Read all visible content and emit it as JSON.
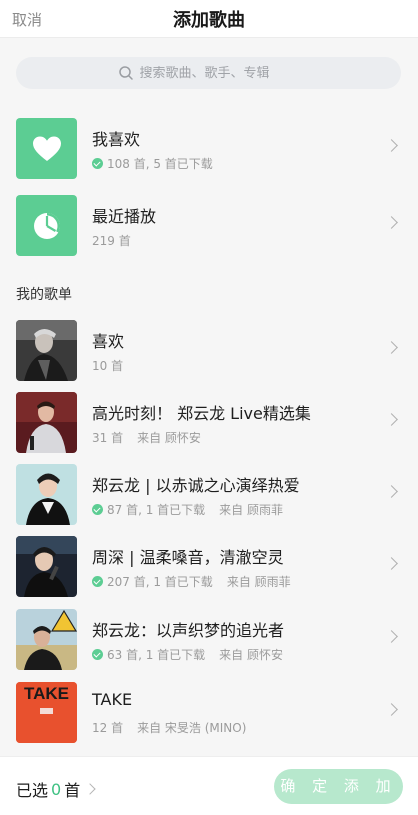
{
  "header": {
    "cancel": "取消",
    "title": "添加歌曲"
  },
  "search": {
    "placeholder": "搜索歌曲、歌手、专辑",
    "icon": "search-icon"
  },
  "top_lists": [
    {
      "name": "我喜欢",
      "meta": "108 首, 5 首已下载",
      "downloaded": true,
      "icon": "heart-icon"
    },
    {
      "name": "最近播放",
      "meta": "219 首",
      "downloaded": false,
      "icon": "clock-icon"
    }
  ],
  "section_title": "我的歌单",
  "playlists": [
    {
      "name": "喜欢",
      "meta": "10 首",
      "source": "",
      "downloaded": false
    },
    {
      "name": "高光时刻！ 郑云龙 Live精选集",
      "meta": "31 首",
      "source": "来自 顾怀安",
      "downloaded": false
    },
    {
      "name": "郑云龙 | 以赤诚之心演绎热爱",
      "meta": "87 首, 1 首已下载",
      "source": "来自 顾雨菲",
      "downloaded": true
    },
    {
      "name": "周深 | 温柔嗓音，清澈空灵",
      "meta": "207 首, 1 首已下载",
      "source": "来自 顾雨菲",
      "downloaded": true
    },
    {
      "name": "郑云龙：以声织梦的追光者",
      "meta": "63 首, 1 首已下载",
      "source": "来自 顾怀安",
      "downloaded": true
    },
    {
      "name": "TAKE",
      "meta": "12 首",
      "source": "来自 宋旻浩 (MINO)",
      "downloaded": false,
      "cover_text": "TAKE"
    }
  ],
  "footer": {
    "selected_prefix": "已选",
    "selected_count": "0",
    "selected_suffix": "首",
    "confirm_label": "确 定 添 加"
  },
  "colors": {
    "accent": "#5ccd93",
    "confirm_disabled": "#b7e8cd"
  }
}
